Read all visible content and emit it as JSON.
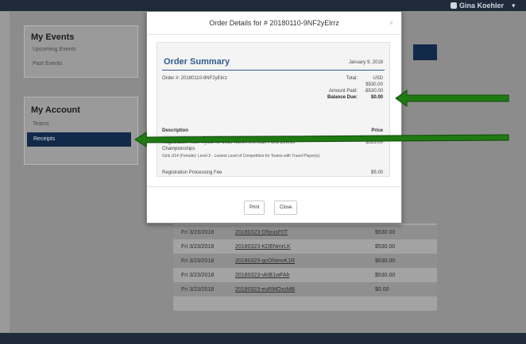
{
  "header": {
    "user_name": "Gina Koehler"
  },
  "sidebar": {
    "my_events": {
      "title": "My Events",
      "items": [
        "Upcoming Events",
        "Past Events"
      ]
    },
    "my_account": {
      "title": "My Account",
      "items": [
        "Teams",
        "Receipts"
      ]
    }
  },
  "modal": {
    "title": "Order Details for # 20180110-9NF2yElrrz",
    "summary_title": "Order Summary",
    "date": "January 9, 2018",
    "order_number": "Order #: 20180110-9NF2yElrrz",
    "total_label": "Total:",
    "total_currency": "USD",
    "total_value": "$530.00",
    "amount_paid_label": "Amount Paid:",
    "amount_paid_value": "-$530.00",
    "balance_due_label": "Balance Due:",
    "balance_due_value": "$0.00",
    "description_header": "Description",
    "price_header": "Price",
    "registration_line": "Registration Team tryout for 2018 North American Fund Events",
    "registration_line_2": "Championships",
    "registration_price": "$525.00",
    "registration_detail": "Girls U14 (Female): Level 2 - Lowest Level of Competition for Teams with Travel Player(s)",
    "processing_label": "Registration Processing Fee",
    "processing_price": "$5.00",
    "print_label": "Print",
    "close_label": "Close"
  },
  "receipts": [
    {
      "date": "Fri 3/23/2018",
      "order": "20180323-DfIpusF0T",
      "amount": "$530.00"
    },
    {
      "date": "Fri 3/23/2018",
      "order": "20180323-KDENmrLK",
      "amount": "$530.00"
    },
    {
      "date": "Fri 3/23/2018",
      "order": "20180323-gcOhImvK1R",
      "amount": "$530.00"
    },
    {
      "date": "Fri 3/23/2018",
      "order": "20180323-vkIB1wFAh",
      "amount": "$530.00"
    },
    {
      "date": "Fri 3/23/2018",
      "order": "20180323-euRMOxsMB",
      "amount": "$0.00"
    }
  ],
  "colors": {
    "accent": "#2f5c8f",
    "nav_dark": "#13294a",
    "arrow": "#1f7a12"
  }
}
